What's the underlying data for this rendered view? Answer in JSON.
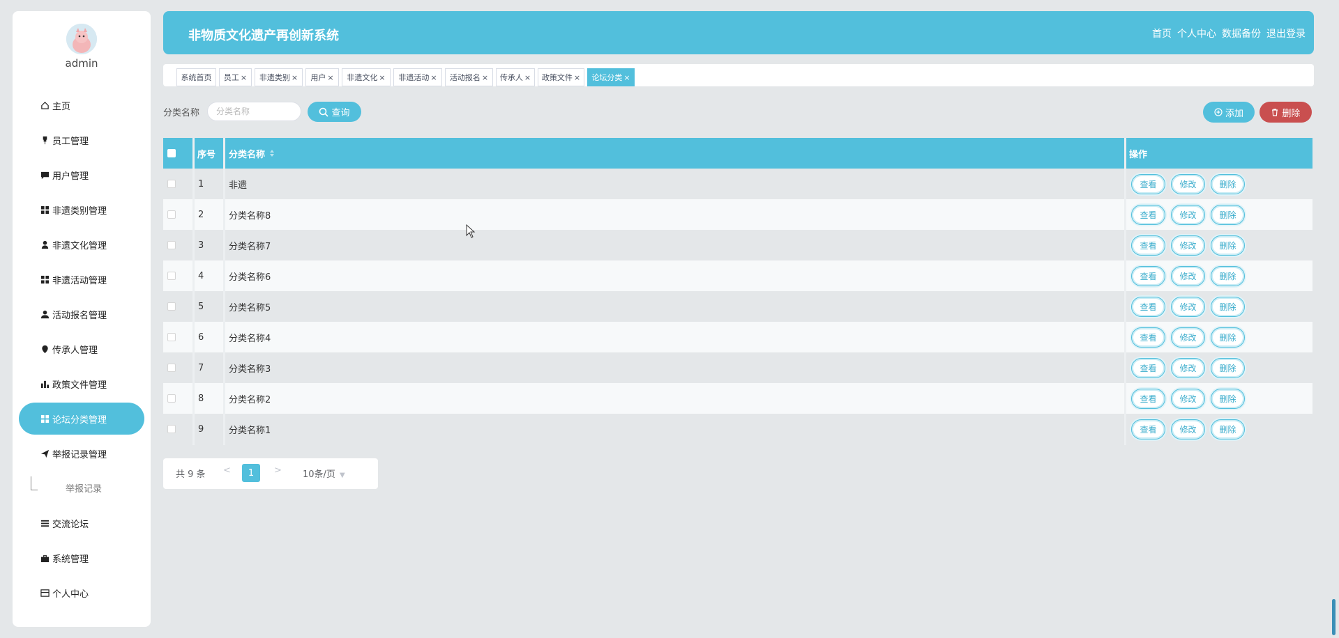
{
  "user": {
    "name": "admin"
  },
  "header": {
    "title": "非物质文化遗产再创新系统",
    "links": [
      "首页",
      "个人中心",
      "数据备份",
      "退出登录"
    ]
  },
  "sidebar": {
    "items": [
      {
        "label": "主页",
        "icon": "home-icon"
      },
      {
        "label": "员工管理",
        "icon": "pin-icon"
      },
      {
        "label": "用户管理",
        "icon": "chat-icon"
      },
      {
        "label": "非遗类别管理",
        "icon": "grid-icon"
      },
      {
        "label": "非遗文化管理",
        "icon": "user-icon"
      },
      {
        "label": "非遗活动管理",
        "icon": "grid-icon"
      },
      {
        "label": "活动报名管理",
        "icon": "person-icon"
      },
      {
        "label": "传承人管理",
        "icon": "location-icon"
      },
      {
        "label": "政策文件管理",
        "icon": "bar-chart-icon"
      },
      {
        "label": "论坛分类管理",
        "icon": "grid-icon",
        "active": true
      },
      {
        "label": "举报记录管理",
        "icon": "send-icon"
      },
      {
        "label": "交流论坛",
        "icon": "list-icon"
      },
      {
        "label": "系统管理",
        "icon": "briefcase-icon"
      },
      {
        "label": "个人中心",
        "icon": "card-icon"
      }
    ],
    "sub_item": "举报记录"
  },
  "tabs": [
    {
      "label": "系统首页",
      "closable": false
    },
    {
      "label": "员工",
      "closable": true
    },
    {
      "label": "非遗类别",
      "closable": true
    },
    {
      "label": "用户",
      "closable": true
    },
    {
      "label": "非遗文化",
      "closable": true
    },
    {
      "label": "非遗活动",
      "closable": true
    },
    {
      "label": "活动报名",
      "closable": true
    },
    {
      "label": "传承人",
      "closable": true
    },
    {
      "label": "政策文件",
      "closable": true
    },
    {
      "label": "论坛分类",
      "closable": true,
      "active": true
    }
  ],
  "search": {
    "label": "分类名称",
    "placeholder": "分类名称",
    "value": "",
    "query_label": "查询"
  },
  "actions": {
    "add_label": "添加",
    "delete_label": "删除"
  },
  "table": {
    "columns": {
      "index": "序号",
      "name": "分类名称",
      "ops": "操作"
    },
    "row_actions": [
      "查看",
      "修改",
      "删除"
    ],
    "rows": [
      {
        "index": "1",
        "name": "非遗"
      },
      {
        "index": "2",
        "name": "分类名称8"
      },
      {
        "index": "3",
        "name": "分类名称7"
      },
      {
        "index": "4",
        "name": "分类名称6"
      },
      {
        "index": "5",
        "name": "分类名称5"
      },
      {
        "index": "6",
        "name": "分类名称4"
      },
      {
        "index": "7",
        "name": "分类名称3"
      },
      {
        "index": "8",
        "name": "分类名称2"
      },
      {
        "index": "9",
        "name": "分类名称1"
      }
    ]
  },
  "pagination": {
    "total": "共 9 条",
    "current": "1",
    "prev": "<",
    "next": ">",
    "page_size": "10条/页"
  },
  "colors": {
    "accent": "#52bfdc",
    "danger": "#c94f4f",
    "background": "#e4e7e9"
  }
}
